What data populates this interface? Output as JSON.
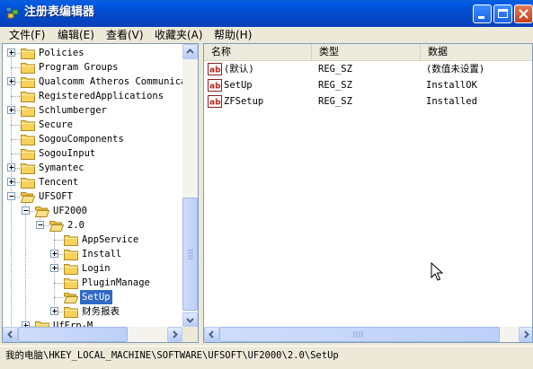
{
  "window": {
    "title": "注册表编辑器"
  },
  "menu": [
    "文件(F)",
    "编辑(E)",
    "查看(V)",
    "收藏夹(A)",
    "帮助(H)"
  ],
  "tree": [
    {
      "label": "Policies",
      "expander": "+"
    },
    {
      "label": "Program Groups",
      "expander": ""
    },
    {
      "label": "Qualcomm Atheros Communicat",
      "expander": "+"
    },
    {
      "label": "RegisteredApplications",
      "expander": ""
    },
    {
      "label": "Schlumberger",
      "expander": "+"
    },
    {
      "label": "Secure",
      "expander": ""
    },
    {
      "label": "SogouComponents",
      "expander": ""
    },
    {
      "label": "SogouInput",
      "expander": ""
    },
    {
      "label": "Symantec",
      "expander": "+"
    },
    {
      "label": "Tencent",
      "expander": "+"
    },
    {
      "label": "UFSOFT",
      "expander": "-"
    },
    {
      "label": "UF2000",
      "expander": "-"
    },
    {
      "label": "2.0",
      "expander": "-"
    },
    {
      "label": "AppService",
      "expander": ""
    },
    {
      "label": "Install",
      "expander": "+"
    },
    {
      "label": "Login",
      "expander": "+"
    },
    {
      "label": "PluginManage",
      "expander": ""
    },
    {
      "label": "SetUp",
      "expander": "",
      "selected": true
    },
    {
      "label": "财务报表",
      "expander": "+"
    },
    {
      "label": "UfErp-M",
      "expander": "+"
    }
  ],
  "list": {
    "columns": [
      "名称",
      "类型",
      "数据"
    ],
    "rows": [
      {
        "name": "(默认)",
        "type": "REG_SZ",
        "data": "(数值未设置)"
      },
      {
        "name": "SetUp",
        "type": "REG_SZ",
        "data": "InstallOK"
      },
      {
        "name": "ZFSetup",
        "type": "REG_SZ",
        "data": "Installed"
      }
    ]
  },
  "status": {
    "path": "我的电脑\\HKEY_LOCAL_MACHINE\\SOFTWARE\\UFSOFT\\UF2000\\2.0\\SetUp"
  },
  "icons": {
    "app": "regedit-icon",
    "folder": "folder-icon",
    "value": "string-value-icon"
  },
  "colors": {
    "titlebar": "#0058e3",
    "selection": "#316ac5",
    "folder": "#f7d25a"
  }
}
